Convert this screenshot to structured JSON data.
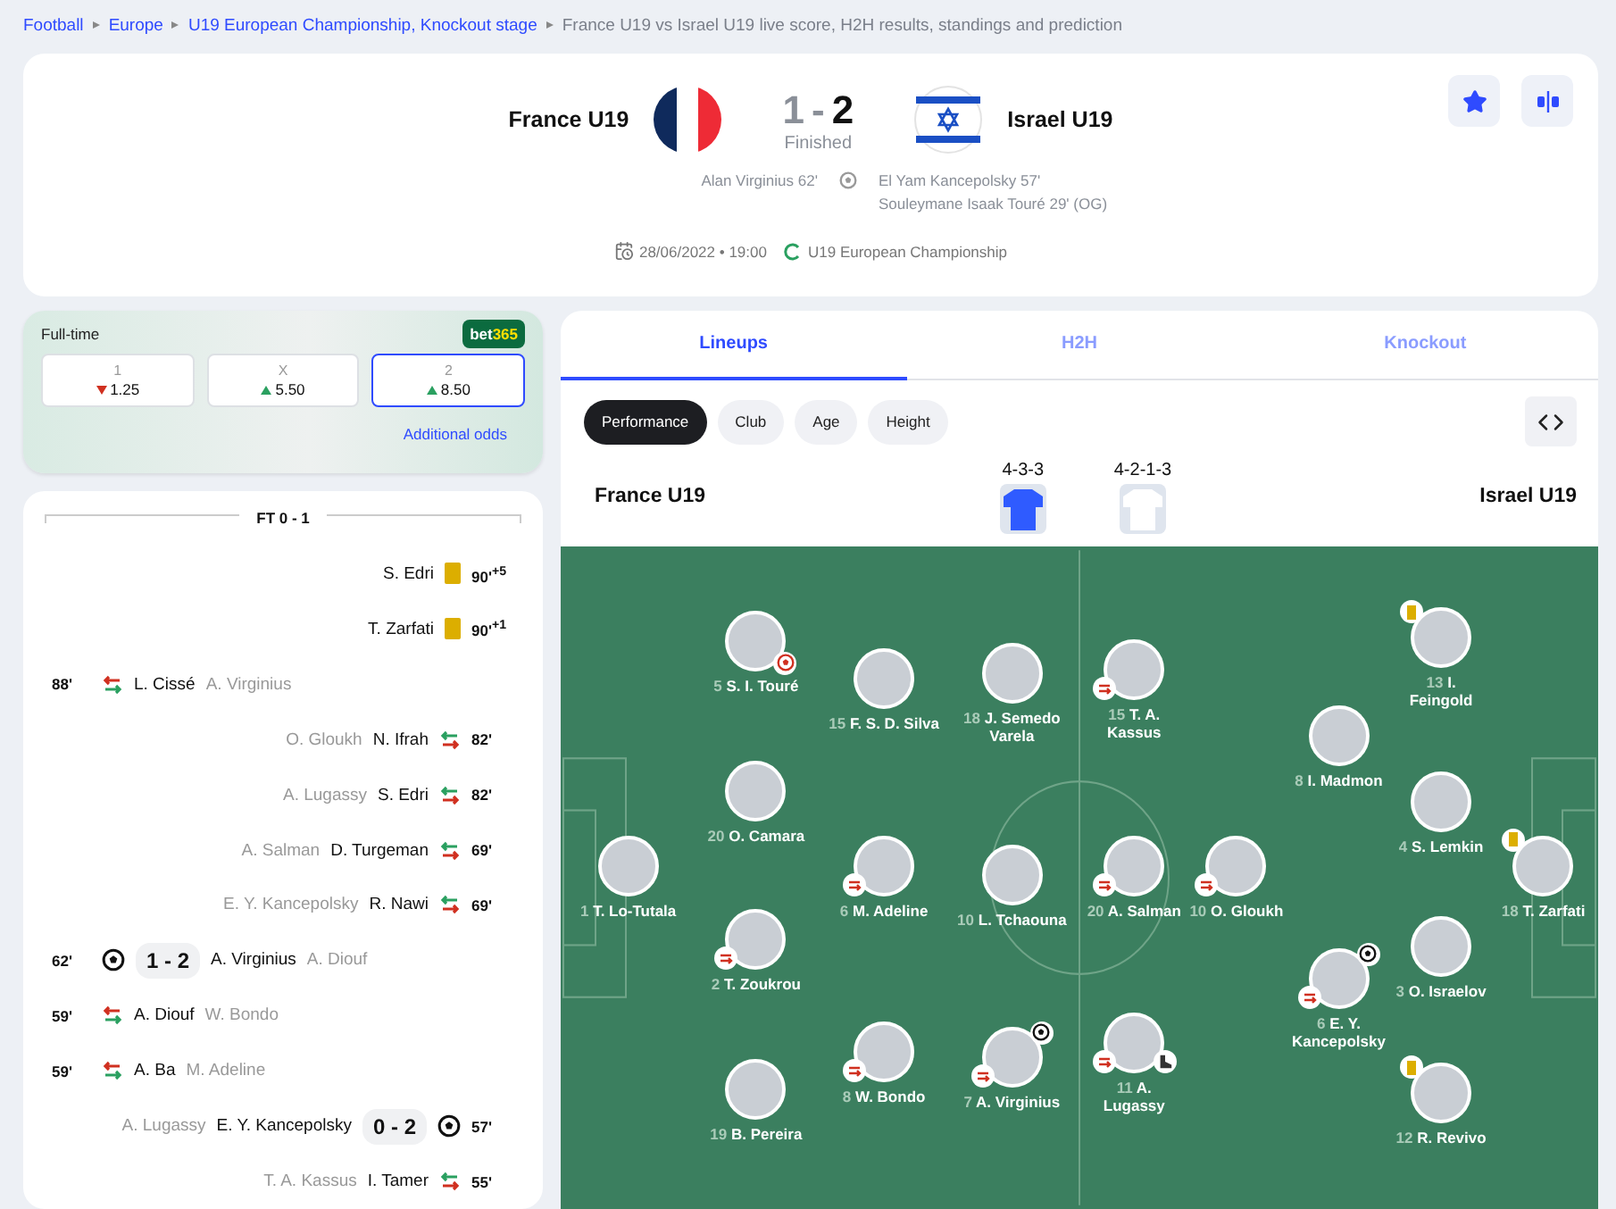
{
  "breadcrumb": [
    {
      "label": "Football",
      "link": true
    },
    {
      "label": "Europe",
      "link": true
    },
    {
      "label": "U19 European Championship, Knockout stage",
      "link": true
    },
    {
      "label": "France U19 vs Israel U19 live score, H2H results, standings and prediction",
      "link": false
    }
  ],
  "match": {
    "home": {
      "name": "France U19",
      "score": "1",
      "winner": false,
      "scorers": [
        "Alan Virginius 62'"
      ]
    },
    "separator": "-",
    "away": {
      "name": "Israel U19",
      "score": "2",
      "winner": true,
      "scorers": [
        "El Yam Kancepolsky 57'",
        "Souleymane Isaak Touré 29' (OG)"
      ]
    },
    "status": "Finished",
    "date": "28/06/2022 • 19:00",
    "competition": "U19 European Championship",
    "favorite": true
  },
  "odds": {
    "title": "Full-time",
    "bookmaker": [
      "bet",
      "365"
    ],
    "link": "Additional odds",
    "items": [
      {
        "label": "1",
        "value": "1.25",
        "rising": false,
        "selected": false
      },
      {
        "label": "X",
        "value": "5.50",
        "rising": true,
        "selected": false
      },
      {
        "label": "2",
        "value": "8.50",
        "rising": true,
        "selected": true
      }
    ]
  },
  "timeline": {
    "title": "FT 0 - 1",
    "events": [
      {
        "away": true,
        "kind": "card",
        "minute": "90'",
        "added": "+5",
        "player": "S. Edri"
      },
      {
        "away": true,
        "kind": "card",
        "minute": "90'",
        "added": "+1",
        "player": "T. Zarfati"
      },
      {
        "away": false,
        "kind": "sub",
        "minute": "88'",
        "player": "L. Cissé",
        "secondary": "A. Virginius"
      },
      {
        "away": true,
        "kind": "sub",
        "minute": "82'",
        "player": "N. Ifrah",
        "secondary": "O. Gloukh"
      },
      {
        "away": true,
        "kind": "sub",
        "minute": "82'",
        "player": "S. Edri",
        "secondary": "A. Lugassy"
      },
      {
        "away": true,
        "kind": "sub",
        "minute": "69'",
        "player": "D. Turgeman",
        "secondary": "A. Salman"
      },
      {
        "away": true,
        "kind": "sub",
        "minute": "69'",
        "player": "R. Nawi",
        "secondary": "E. Y. Kancepolsky"
      },
      {
        "away": false,
        "kind": "goal",
        "minute": "62'",
        "score": "1 - 2",
        "player": "A. Virginius",
        "secondary": "A. Diouf"
      },
      {
        "away": false,
        "kind": "sub",
        "minute": "59'",
        "player": "A. Diouf",
        "secondary": "W. Bondo"
      },
      {
        "away": false,
        "kind": "sub",
        "minute": "59'",
        "player": "A. Ba",
        "secondary": "M. Adeline"
      },
      {
        "away": true,
        "kind": "goal",
        "minute": "57'",
        "score": "0 - 2",
        "player": "E. Y. Kancepolsky",
        "secondary": "A. Lugassy"
      },
      {
        "away": true,
        "kind": "sub",
        "minute": "55'",
        "player": "I. Tamer",
        "secondary": "T. A. Kassus"
      }
    ]
  },
  "tabs": [
    {
      "label": "Lineups",
      "selected": true
    },
    {
      "label": "H2H",
      "selected": false
    },
    {
      "label": "Knockout",
      "selected": false
    }
  ],
  "filters": [
    {
      "label": "Performance",
      "selected": true
    },
    {
      "label": "Club",
      "selected": false
    },
    {
      "label": "Age",
      "selected": false
    },
    {
      "label": "Height",
      "selected": false
    }
  ],
  "lineups": {
    "home": {
      "name": "France U19",
      "formation": "4-3-3",
      "color": "#2f5bff",
      "lines": [
        [
          {
            "number": "1",
            "name": "T. Lo-Tutala"
          }
        ],
        [
          {
            "number": "5",
            "name": "S. I. Touré",
            "own_goal": true
          },
          {
            "number": "20",
            "name": "O. Camara"
          },
          {
            "number": "2",
            "name": "T. Zoukrou",
            "substituted": true
          },
          {
            "number": "19",
            "name": "B. Pereira"
          }
        ],
        [
          {
            "number": "15",
            "name": "F. S. D. Silva"
          },
          {
            "number": "6",
            "name": "M. Adeline",
            "substituted": true
          },
          {
            "number": "8",
            "name": "W. Bondo",
            "substituted": true
          }
        ],
        [
          {
            "number": "18",
            "name": "J. Semedo Varela"
          },
          {
            "number": "10",
            "name": "L. Tchaouna"
          },
          {
            "number": "7",
            "name": "A. Virginius",
            "substituted": true,
            "scored": true
          }
        ]
      ]
    },
    "away": {
      "name": "Israel U19",
      "formation": "4-2-1-3",
      "color": "#ffffff",
      "lines": [
        [
          {
            "number": "15",
            "name": "T. A. Kassus",
            "substituted": true
          },
          {
            "number": "20",
            "name": "A. Salman",
            "substituted": true
          },
          {
            "number": "11",
            "name": "A. Lugassy",
            "substituted": true,
            "assist": true
          }
        ],
        [
          {
            "number": "10",
            "name": "O. Gloukh",
            "substituted": true
          }
        ],
        [
          {
            "number": "8",
            "name": "I. Madmon"
          },
          {
            "number": "6",
            "name": "E. Y. Kancepolsky",
            "substituted": true,
            "scored": true
          }
        ],
        [
          {
            "number": "13",
            "name": "I. Feingold",
            "booked": true
          },
          {
            "number": "4",
            "name": "S. Lemkin"
          },
          {
            "number": "3",
            "name": "O. Israelov"
          },
          {
            "number": "12",
            "name": "R. Revivo",
            "booked": true
          }
        ],
        [
          {
            "number": "18",
            "name": "T. Zarfati",
            "booked": true
          }
        ]
      ]
    }
  }
}
